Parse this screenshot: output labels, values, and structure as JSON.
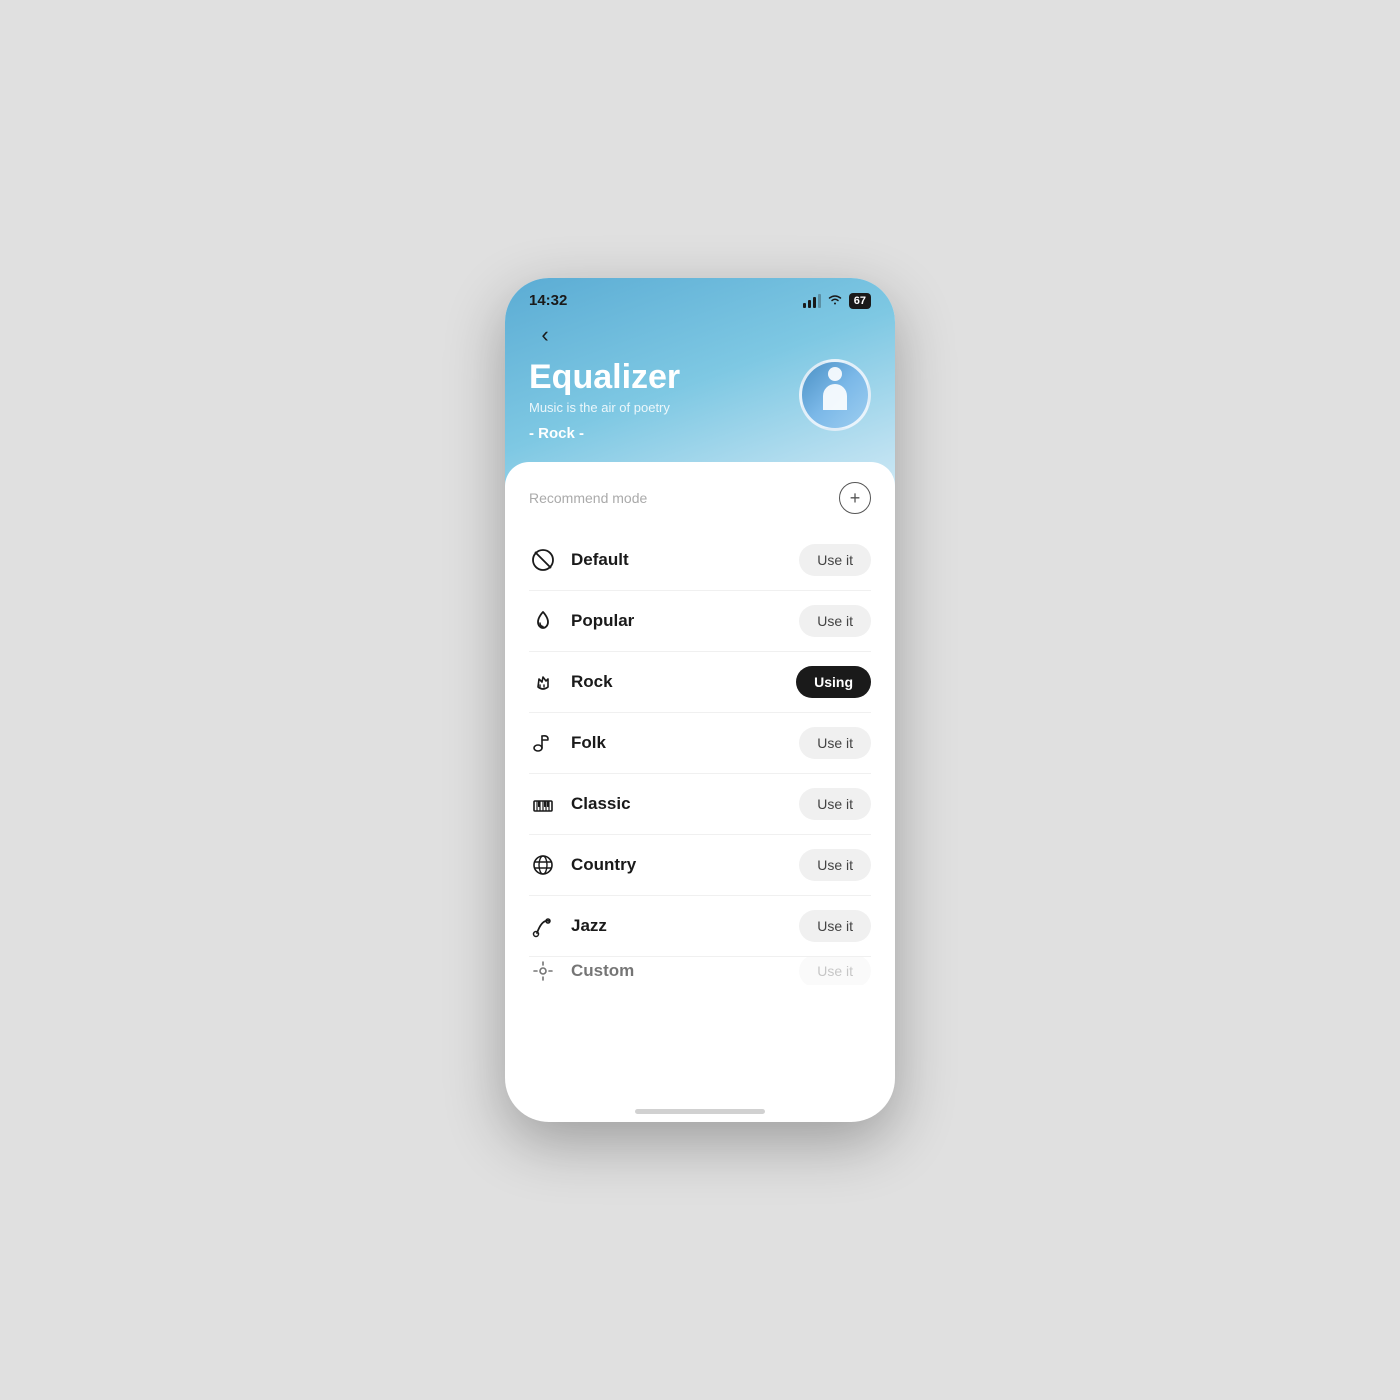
{
  "statusBar": {
    "time": "14:32",
    "battery": "67"
  },
  "header": {
    "title": "Equalizer",
    "subtitle": "Music is the air of poetry",
    "currentMode": "- Rock -",
    "backLabel": "back"
  },
  "card": {
    "recommendLabel": "Recommend mode",
    "addButtonLabel": "+"
  },
  "modes": [
    {
      "id": "default",
      "name": "Default",
      "icon": "no-symbol",
      "state": "use",
      "buttonLabel": "Use it",
      "active": false
    },
    {
      "id": "popular",
      "name": "Popular",
      "icon": "fire",
      "state": "use",
      "buttonLabel": "Use it",
      "active": false
    },
    {
      "id": "rock",
      "name": "Rock",
      "icon": "rock-hand",
      "state": "using",
      "buttonLabel": "Using",
      "active": true
    },
    {
      "id": "folk",
      "name": "Folk",
      "icon": "guitar",
      "state": "use",
      "buttonLabel": "Use it",
      "active": false
    },
    {
      "id": "classic",
      "name": "Classic",
      "icon": "piano",
      "state": "use",
      "buttonLabel": "Use it",
      "active": false
    },
    {
      "id": "country",
      "name": "Country",
      "icon": "country",
      "state": "use",
      "buttonLabel": "Use it",
      "active": false
    },
    {
      "id": "jazz",
      "name": "Jazz",
      "icon": "jazz",
      "state": "use",
      "buttonLabel": "Use it",
      "active": false
    },
    {
      "id": "custom",
      "name": "Custom",
      "icon": "custom",
      "state": "use",
      "buttonLabel": "Use it",
      "active": false
    }
  ]
}
